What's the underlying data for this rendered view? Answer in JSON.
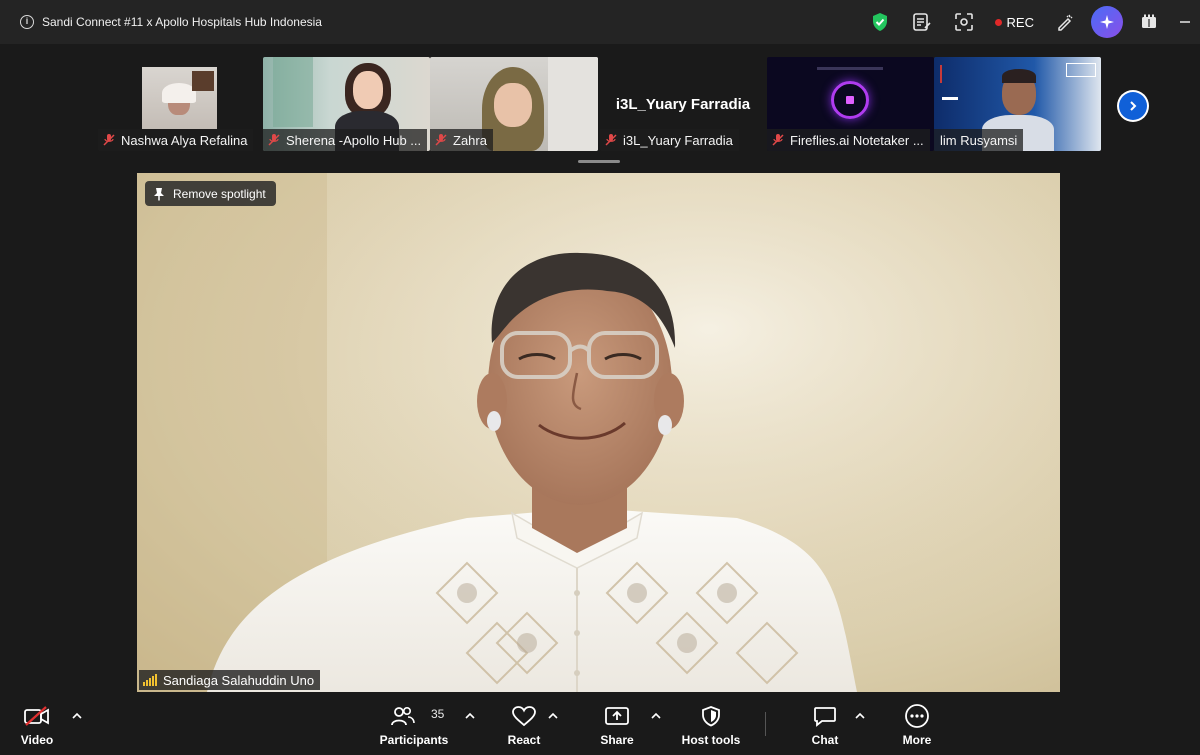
{
  "window": {
    "title": "Sandi Connect #11 x Apollo Hospitals Hub Indonesia",
    "rec_label": "REC"
  },
  "icons": {
    "info": "info-circle-icon",
    "security": "shield-check-icon",
    "notes": "notes-icon",
    "focus": "focus-frame-icon",
    "annotate": "pen-icon",
    "ai": "sparkle-icon",
    "apps": "apps-icon",
    "minimize": "minimize-icon"
  },
  "participants_strip": [
    {
      "name": "Nashwa Alya Refalina",
      "muted": true
    },
    {
      "name": "Sherena -Apollo Hub ...",
      "muted": true
    },
    {
      "name": "Zahra",
      "muted": true
    },
    {
      "name": "i3L_Yuary Farradia",
      "muted": true,
      "display_text": "i3L_Yuary Farradia"
    },
    {
      "name": "Fireflies.ai Notetaker ...",
      "muted": true
    },
    {
      "name": "lim Rusyamsi",
      "muted": false
    }
  ],
  "spotlight": {
    "remove_label": "Remove spotlight",
    "speaker_name": "Sandiaga Salahuddin Uno"
  },
  "toolbar": {
    "video_label": "Video",
    "participants_label": "Participants",
    "participants_count": "35",
    "react_label": "React",
    "share_label": "Share",
    "host_tools_label": "Host tools",
    "chat_label": "Chat",
    "more_label": "More"
  },
  "colors": {
    "background": "#1a1a1a",
    "titlebar": "#242424",
    "rec_red": "#e02828",
    "security_green": "#23c55e",
    "accent_blue": "#1060d8",
    "audio_bars": "#f2c230"
  }
}
